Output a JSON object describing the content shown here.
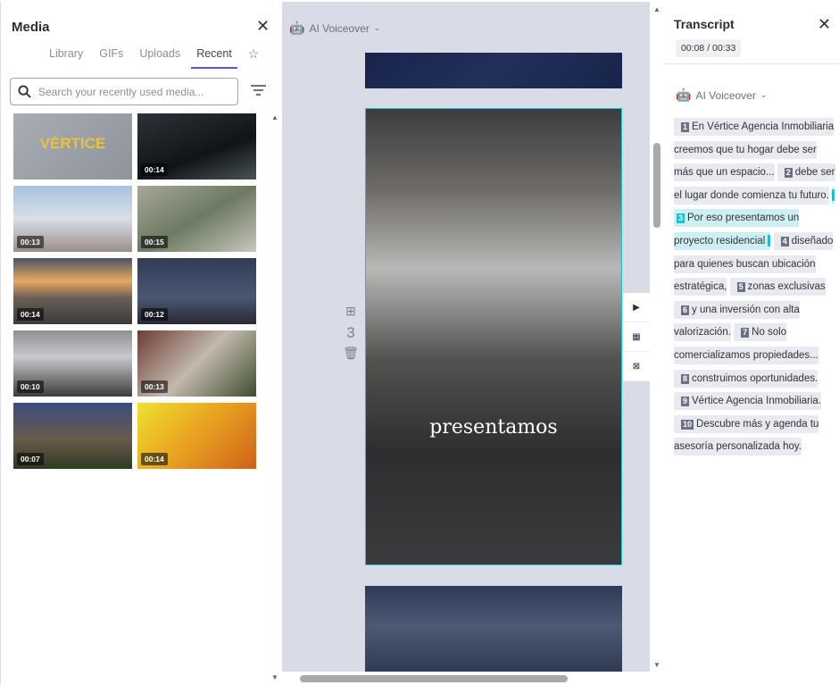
{
  "media": {
    "title": "Media",
    "tabs": [
      "Library",
      "GIFs",
      "Uploads",
      "Recent"
    ],
    "active_tab": "Recent",
    "search_placeholder": "Search your recently used media...",
    "items": [
      {
        "logo": "VÉRTICE",
        "duration": "",
        "bg": "linear-gradient(135deg,#a8adb3,#8e949b)"
      },
      {
        "duration": "00:14",
        "bg": "linear-gradient(160deg,#2c3238,#0f1418 60%,#4b5358)"
      },
      {
        "duration": "00:13",
        "bg": "linear-gradient(180deg,#a9c2de,#d8dfe8 50%,#9a8f88)"
      },
      {
        "duration": "00:15",
        "bg": "linear-gradient(150deg,#a9a79b,#6c7a62 50%,#c9c6bc)"
      },
      {
        "duration": "00:14",
        "bg": "linear-gradient(180deg,#4a5566,#e8a860 35%,#6a6056 60%,#3c3a3c)"
      },
      {
        "duration": "00:12",
        "bg": "linear-gradient(180deg,#313c58,#4a5672 60%,#2a2a33)"
      },
      {
        "duration": "00:10",
        "bg": "linear-gradient(180deg,#8d8f93,#c7c9cd 40%,#3f3c3a)"
      },
      {
        "duration": "00:13",
        "bg": "linear-gradient(135deg,#6f3b34,#c2b9ad 50%,#3f4d2d)"
      },
      {
        "duration": "00:07",
        "bg": "linear-gradient(180deg,#3a4d80,#6a5b4a 55%,#2d3a22)"
      },
      {
        "duration": "00:14",
        "bg": "linear-gradient(135deg,#f0e030,#e8a020 50%,#d0601a)"
      }
    ]
  },
  "canvas": {
    "voiceover_label": "AI Voiceover",
    "scene_number": "3",
    "caption": "presentamos"
  },
  "transcript": {
    "title": "Transcript",
    "time": "00:08 / 00:33",
    "voiceover_label": "AI Voiceover",
    "segments": [
      {
        "n": "1",
        "text": "En Vértice Agencia Inmobiliaria creemos que tu hogar debe ser más que un espacio..."
      },
      {
        "n": "2",
        "text": "debe ser el lugar donde comienza tu futuro."
      },
      {
        "n": "3",
        "text": "Por eso presentamos un proyecto residencial",
        "current": true
      },
      {
        "n": "4",
        "text": "diseñado para quienes buscan ubicación estratégica,"
      },
      {
        "n": "5",
        "text": "zonas exclusivas"
      },
      {
        "n": "6",
        "text": "y una inversión con alta valorización."
      },
      {
        "n": "7",
        "text": "No solo comercializamos propiedades..."
      },
      {
        "n": "8",
        "text": "construimos oportunidades."
      },
      {
        "n": "9",
        "text": "Vértice Agencia Inmobiliaria."
      },
      {
        "n": "10",
        "text": "Descubre más y agenda tu asesoría personalizada hoy."
      }
    ]
  },
  "colors": {
    "accent": "#5a55d6",
    "current": "#17c3d3"
  }
}
